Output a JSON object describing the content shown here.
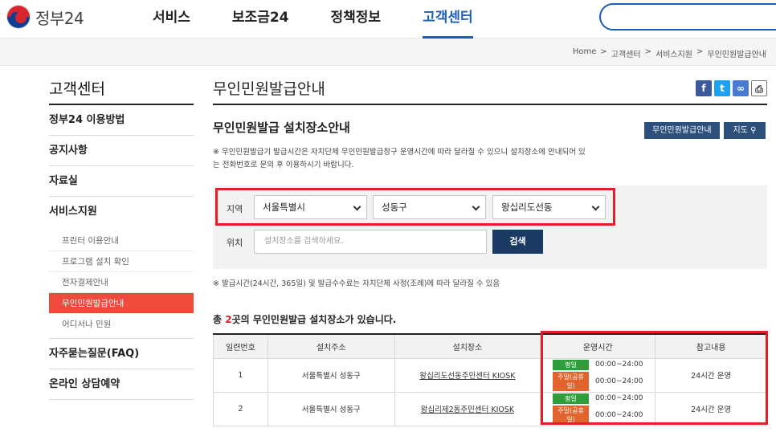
{
  "header": {
    "logo_text": "정부24",
    "nav": [
      "서비스",
      "보조금24",
      "정책정보",
      "고객센터"
    ],
    "active_nav": 3
  },
  "breadcrumb": [
    "Home",
    ">",
    "고객센터",
    ">",
    "서비스지원",
    ">",
    "무인민원발급안내"
  ],
  "sidebar": {
    "title": "고객센터",
    "items": [
      "정부24 이용방법",
      "공지사항",
      "자료실",
      "서비스지원"
    ],
    "subitems": [
      "프린터 이용안내",
      "프로그램 설치 확인",
      "전자결제안내",
      "무인민원발급안내",
      "어디서나 민원"
    ],
    "active_sub": 3,
    "bottom_items": [
      "자주묻는질문(FAQ)",
      "온라인 상담예약"
    ]
  },
  "main": {
    "page_title": "무인민원발급안내",
    "section_title": "무인민원발급 설치장소안내",
    "btn_guide": "무인민원발급안내",
    "btn_map": "지도",
    "notice1": "※ 무인민원발급기 발급시간은 자치단체 무인민원발급창구 운영시간에 따라 달라질 수 있으니 설치장소에 안내되어 있는 전화번호로 문의 후 이용하시기 바랍니다.",
    "region_label": "지역",
    "location_label": "위치",
    "select_city": "서울특별시",
    "select_district": "성동구",
    "select_dong": "왕십리도선동",
    "place_placeholder": "설치장소를 검색하세요.",
    "search_btn": "검색",
    "notice2": "※ 발급시간(24시간, 365일) 및 발급수수료는 자치단체 사정(조례)에 따라 달라질 수 있음",
    "count_prefix": "총 ",
    "count_num": "2",
    "count_suffix": "곳의 무인민원발급 설치장소가 있습니다."
  },
  "table": {
    "headers": [
      "일련번호",
      "설치주소",
      "설치장소",
      "운영시간",
      "참고내용"
    ],
    "rows": [
      {
        "no": "1",
        "address": "서울특별시 성동구",
        "place": "왕십리도선동주민센터 KIOSK",
        "weekday_label": "평일",
        "weekday_time": "00:00~24:00",
        "holiday_label": "주말(공휴일)",
        "holiday_time": "00:00~24:00",
        "note": "24시간 운영"
      },
      {
        "no": "2",
        "address": "서울특별시 성동구",
        "place": "왕십리제2동주민센터 KIOSK",
        "weekday_label": "평일",
        "weekday_time": "00:00~24:00",
        "holiday_label": "주말(공휴일)",
        "holiday_time": "00:00~24:00",
        "note": "24시간 운영"
      }
    ]
  },
  "colors": {
    "accent_blue": "#1a5fb4",
    "highlight_red": "#e41e26",
    "active_sidebar": "#ef4a3c",
    "badge_green": "#2e9e3a",
    "badge_orange": "#e2632c"
  }
}
